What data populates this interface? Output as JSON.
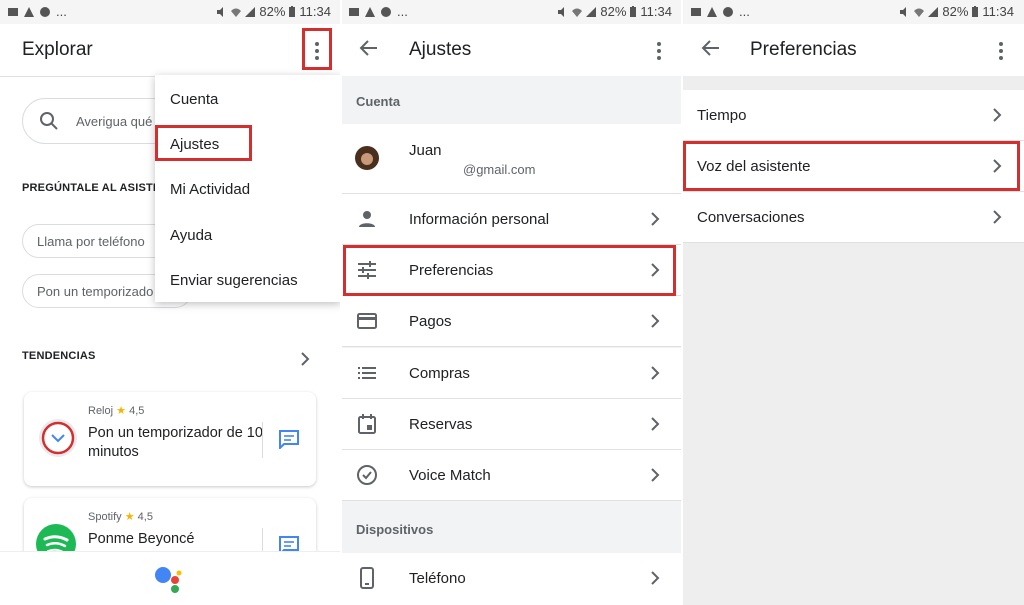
{
  "status_bar": {
    "time": "11:34",
    "battery": "82%",
    "ellipsis": "..."
  },
  "panel1": {
    "title": "Explorar",
    "search_placeholder": "Averigua qué",
    "section_ask": "PREGÚNTALE AL ASISTEN",
    "chips": [
      "Llama por teléfono",
      "Pon un temporizado"
    ],
    "section_trends": "TENDENCIAS",
    "cards": [
      {
        "app": "Reloj",
        "rating": "4,5",
        "title": "Pon un temporizador de 10 minutos"
      },
      {
        "app": "Spotify",
        "rating": "4,5",
        "title": "Ponme Beyoncé"
      }
    ],
    "menu": [
      "Cuenta",
      "Ajustes",
      "Mi Actividad",
      "Ayuda",
      "Enviar sugerencias"
    ]
  },
  "panel2": {
    "title": "Ajustes",
    "section_account": "Cuenta",
    "user_name": "Juan",
    "user_email": "@gmail.com",
    "items": [
      "Información personal",
      "Preferencias",
      "Pagos",
      "Compras",
      "Reservas",
      "Voice Match"
    ],
    "section_devices": "Dispositivos",
    "device_item": "Teléfono"
  },
  "panel3": {
    "title": "Preferencias",
    "items": [
      "Tiempo",
      "Voz del asistente",
      "Conversaciones"
    ]
  },
  "colors": {
    "highlight": "#d32f2f",
    "google_blue": "#4285f4",
    "google_red": "#ea4335",
    "google_yellow": "#fbbc05",
    "google_green": "#34a853",
    "spotify": "#1db954"
  }
}
